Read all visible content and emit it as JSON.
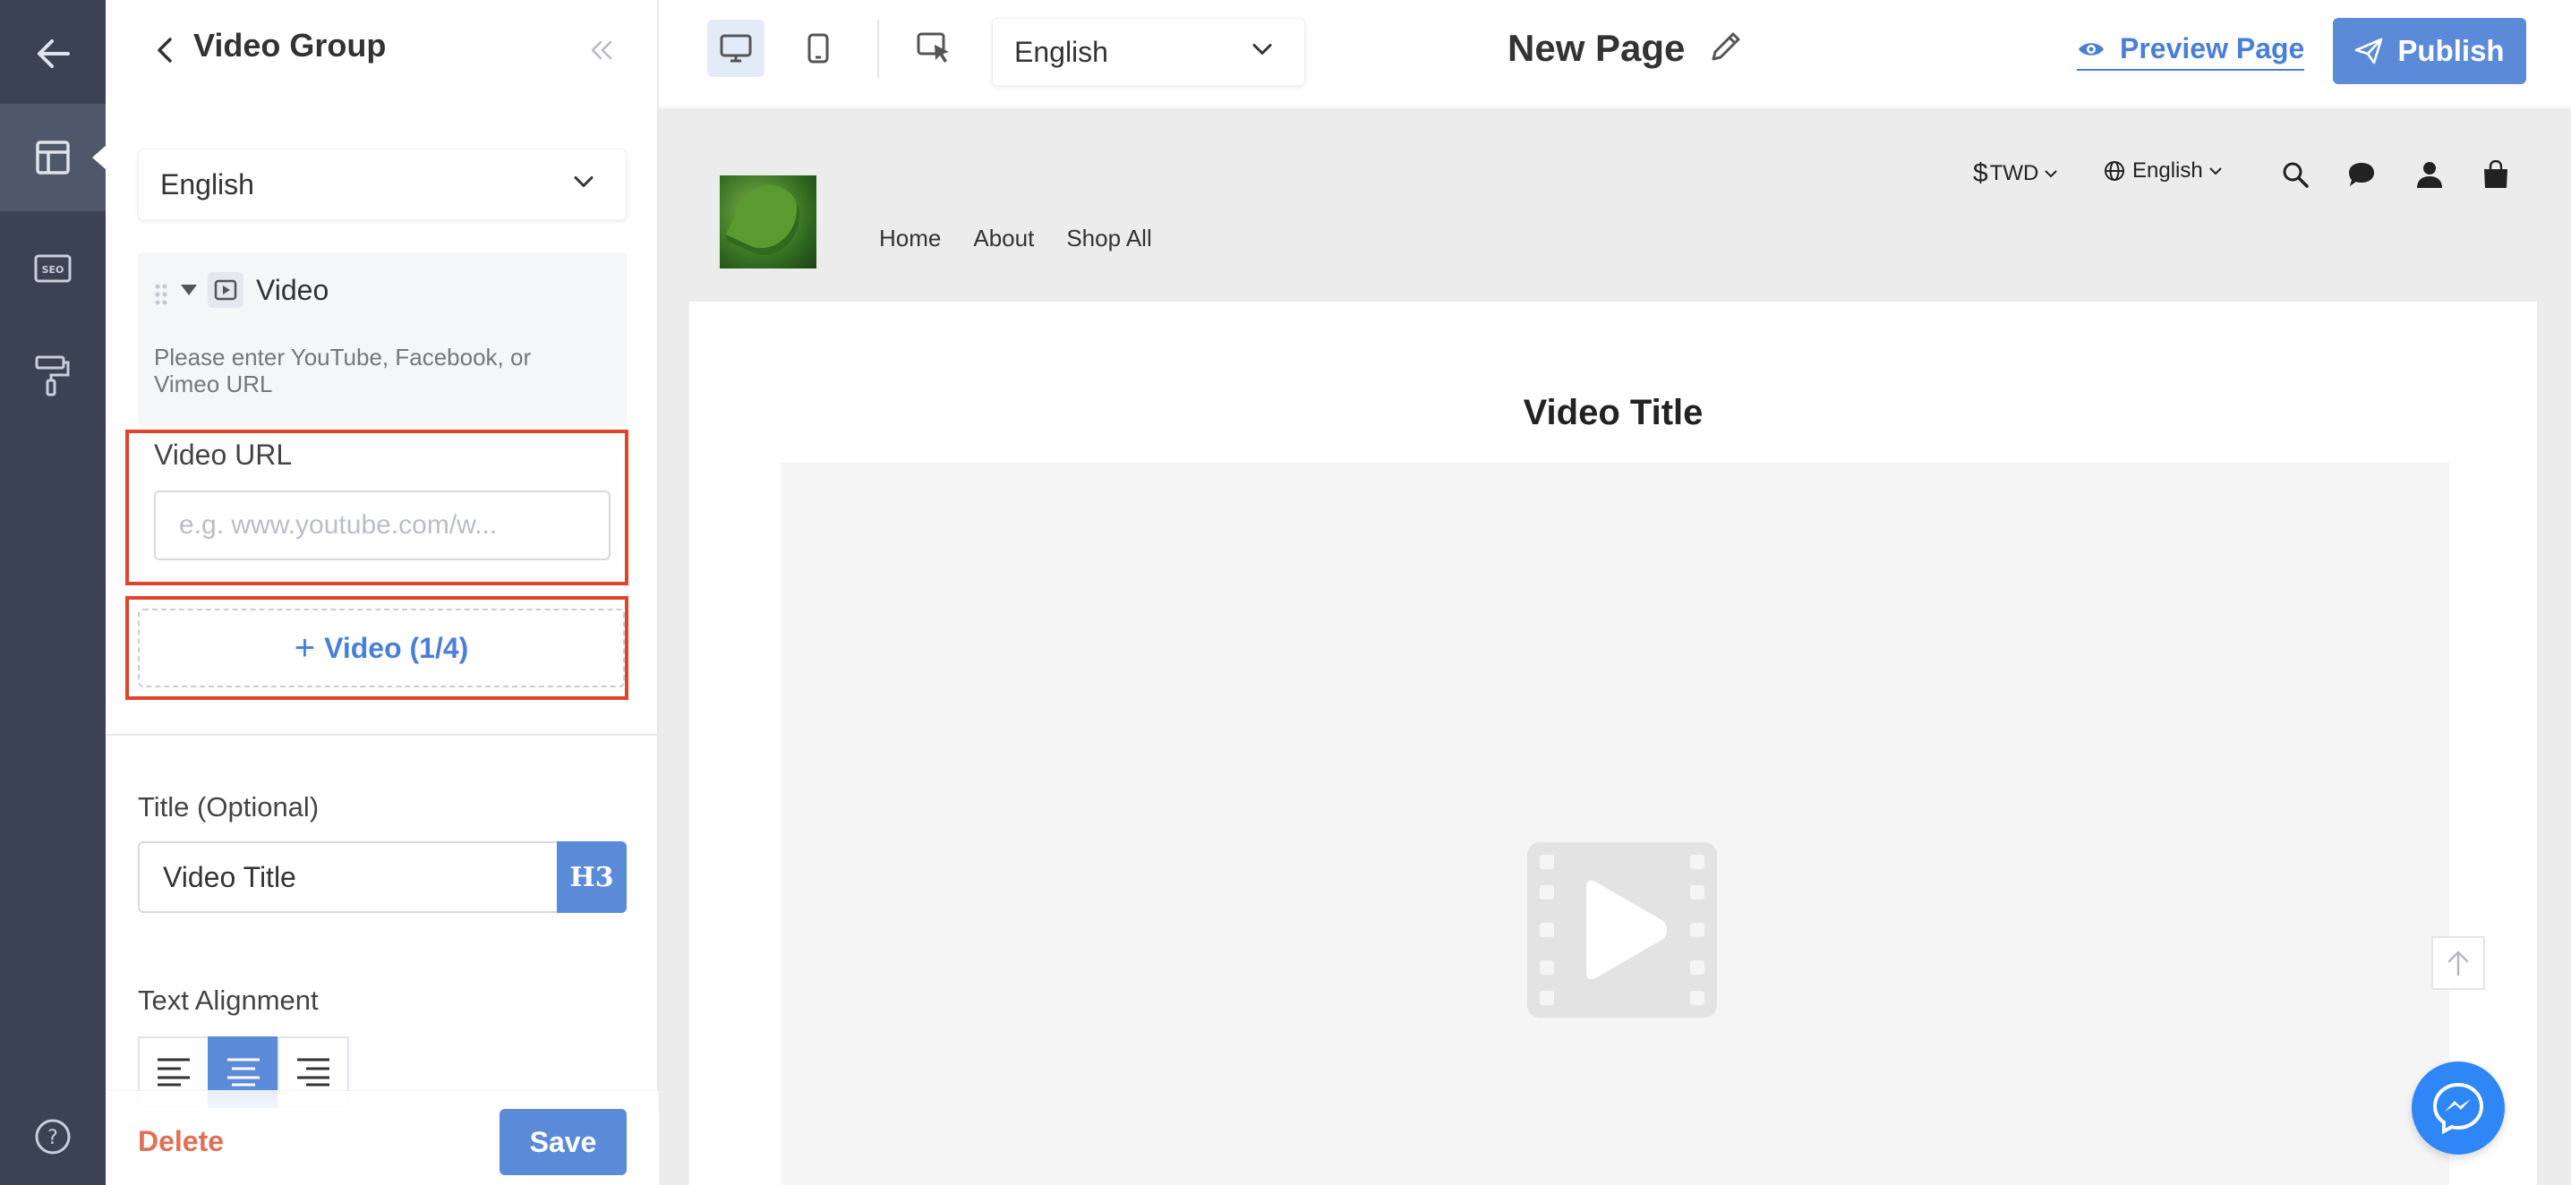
{
  "rail": {
    "items": [
      {
        "name": "back-arrow-icon"
      },
      {
        "name": "layout-icon",
        "active": true
      },
      {
        "name": "seo-icon",
        "label": "SEO"
      },
      {
        "name": "paint-roller-icon"
      },
      {
        "name": "help-icon",
        "label": "?"
      }
    ]
  },
  "sidebar": {
    "title": "Video Group",
    "language_select": "English",
    "video_item": {
      "label": "Video",
      "help_text": "Please enter YouTube, Facebook, or Vimeo URL"
    },
    "video_url": {
      "label": "Video URL",
      "placeholder": "e.g. www.youtube.com/w..."
    },
    "add_video_label": "Video (1/4)",
    "title_field": {
      "label": "Title (Optional)",
      "value": "Video Title",
      "heading_level": "H3"
    },
    "text_alignment": {
      "label": "Text Alignment",
      "options": [
        "left",
        "center",
        "right"
      ],
      "selected": "center"
    },
    "footer": {
      "delete_label": "Delete",
      "save_label": "Save"
    }
  },
  "topbar": {
    "language_select": "English",
    "page_title": "New Page",
    "preview_label": "Preview Page",
    "publish_label": "Publish",
    "accent_color": "#5b8ad8"
  },
  "site": {
    "nav": [
      "Home",
      "About",
      "Shop All"
    ],
    "currency": "TWD",
    "currency_symbol": "$",
    "language": "English",
    "section_title": "Video Title"
  }
}
